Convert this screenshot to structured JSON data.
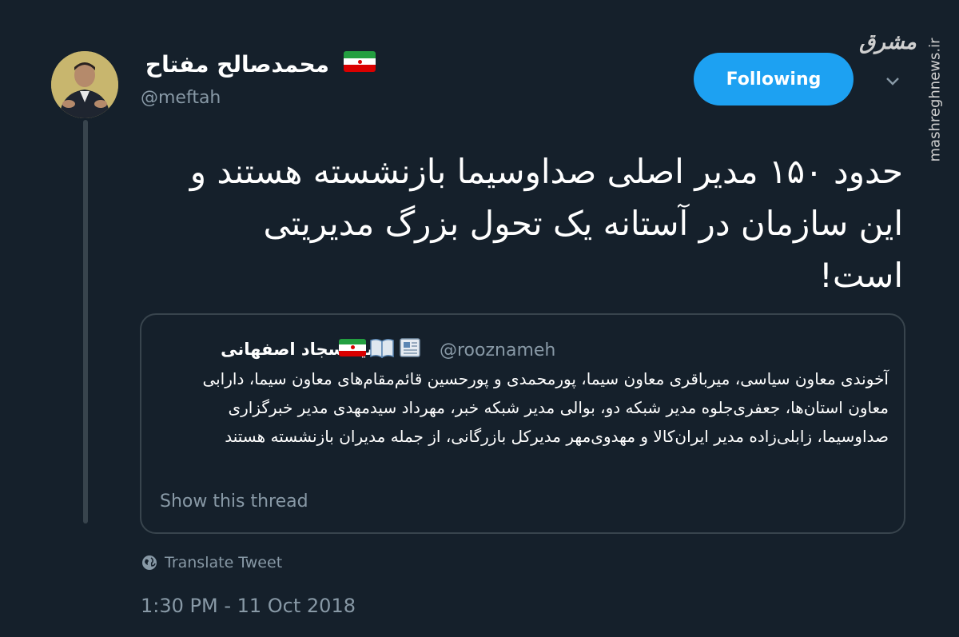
{
  "author": {
    "name": "محمدصالح مفتاح",
    "handle": "@meftah"
  },
  "follow_button": {
    "label": "Following"
  },
  "watermark": {
    "logo": "مشرق",
    "url": "mashreghnews.ir"
  },
  "tweet": {
    "text": "حدود ۱۵۰ مدیر اصلی صداوسیما بازنشسته هستند و این سازمان در آستانه یک تحول بزرگ مدیریتی است!",
    "timestamp": "1:30 PM - 11 Oct 2018",
    "translate_label": "Translate Tweet"
  },
  "quoted_tweet": {
    "name": "سید سجاد اصفهانی",
    "handle": "@rooznameh",
    "text": "آخوندی معاون سیاسی، میرباقری معاون سیما، پورمحمدی و پورحسین قائم‌مقام‌های معاون سیما، دارابی معاون استان‌ها، جعفری‌جلوه مدیر شبکه دو، بوالی مدیر شبکه خبر، مهرداد سیدمهدی مدیر خبرگزاری صداوسیما، زابلی‌زاده مدیر ایران‌کالا و مهدوی‌مهر مدیرکل بازرگانی، از جمله مدیران بازنشسته هستند",
    "thread_link": "Show this thread"
  },
  "colors": {
    "background": "#15202b",
    "accent": "#1da1f2",
    "muted_text": "#8899a6",
    "border": "#38444d"
  },
  "icons": [
    "iran-flag-icon",
    "chevron-down-icon",
    "book-icon",
    "newspaper-icon",
    "globe-icon"
  ]
}
